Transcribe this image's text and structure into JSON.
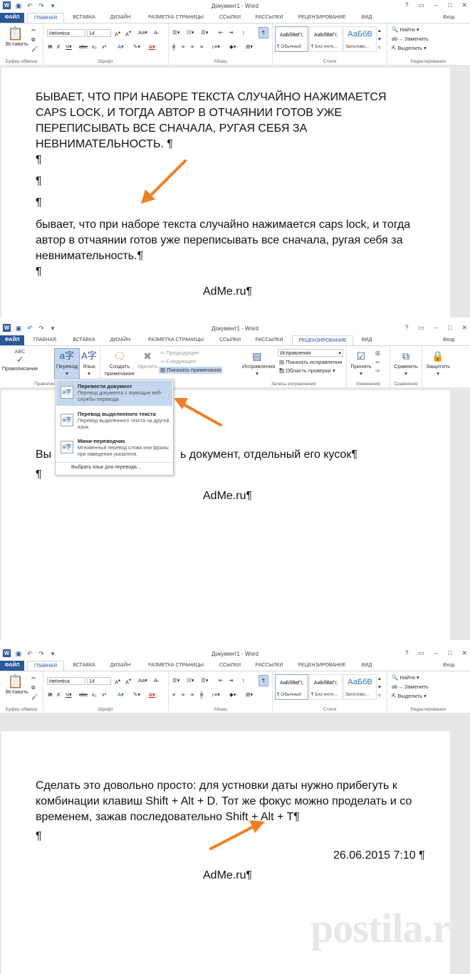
{
  "panels": [
    {
      "title": "Документ1 - Word",
      "tabs": [
        "ФАЙЛ",
        "ГЛАВНАЯ",
        "ВСТАВКА",
        "ДИЗАЙН",
        "РАЗМЕТКА СТРАНИЦЫ",
        "ССЫЛКИ",
        "РАССЫЛКИ",
        "РЕЦЕНЗИРОВАНИЕ",
        "ВИД"
      ],
      "signin": "Вход",
      "ribbon": {
        "paste": "Вставить",
        "clipboard": "Буфер обмена",
        "font_name": "Helvetica",
        "font_size": "14",
        "font_group": "Шрифт",
        "para_group": "Абзац",
        "styles": [
          {
            "preview": "АаБбВвГг,",
            "name": "¶ Обычный"
          },
          {
            "preview": "АаБбВвГг,",
            "name": "¶ Без инте..."
          },
          {
            "preview": "АаБбВ",
            "name": "Заголово..."
          }
        ],
        "styles_group": "Стили",
        "find": "Найти",
        "replace": "Заменить",
        "select": "Выделить",
        "edit_group": "Редактирование"
      },
      "doc": {
        "caps_lines": [
          "БЫВАЕТ, ЧТО ПРИ НАБОРЕ ТЕКСТА СЛУЧАЙНО НАЖИМАЕТСЯ",
          "CAPS LOCK, И ТОГДА АВТОР В ОТЧАЯНИИ ГОТОВ УЖЕ",
          "ПЕРЕПИСЫВАТЬ ВСЕ СНАЧАЛА, РУГАЯ СЕБЯ ЗА",
          "НЕВНИМАТЕЛЬНОСТЬ. ¶"
        ],
        "pilcrows": [
          "¶",
          "¶",
          "¶"
        ],
        "lower_lines": [
          "бывает, что при наборе текста случайно нажимается caps lock, и тогда",
          "автор в отчаянии готов уже переписывать все сначала, ругая себя за",
          "невнимательность.¶"
        ],
        "end_pilcrow": "¶",
        "footer": "AdMe.ru¶"
      }
    },
    {
      "title": "Документ1 - Word",
      "tabs": [
        "ФАЙЛ",
        "ГЛАВНАЯ",
        "ВСТАВКА",
        "ДИЗАЙН",
        "РАЗМЕТКА СТРАНИЦЫ",
        "ССЫЛКИ",
        "РАССЫЛКИ",
        "РЕЦЕНЗИРОВАНИЕ",
        "ВИД"
      ],
      "signin": "Вход",
      "ribbon": {
        "spelling": "Правописание",
        "translate": "Перевод",
        "language": "Язык",
        "create_comment": "Создать примечание",
        "delete": "Удалить",
        "prev": "Предыдущее",
        "next": "Следующее",
        "show_comments": "Показать примечания",
        "corrections": "Исправления",
        "corrections_mode": "Исправления",
        "show_markup": "Показать исправления",
        "review_pane": "Область проверки",
        "accept": "Принять",
        "compare": "Сравнить",
        "protect": "Защитить",
        "proofing_group": "Правописание",
        "tracking_group": "Запись исправлений",
        "changes_group": "Изменения",
        "compare_group": "Сравнение"
      },
      "dropdown": [
        {
          "title": "Перевести документ",
          "desc": "Перевод документа с помощью веб-службы перевода"
        },
        {
          "title": "Перевод выделенного текста",
          "desc": "Перевод выделенного текста на другой язык."
        },
        {
          "title": "Мини-переводчик",
          "desc": "Мгновенный перевод слова или фразы при наведении указателя."
        }
      ],
      "dropdown_footer": "Выбрать язык для перевода...",
      "doc": {
        "line_start": "Вы",
        "line_end": "ь документ, отдельный его кусок¶",
        "pilcrow": "¶",
        "footer": "AdMe.ru¶"
      }
    },
    {
      "title": "Документ1 - Word",
      "tabs": [
        "ФАЙЛ",
        "ГЛАВНАЯ",
        "ВСТАВКА",
        "ДИЗАЙН",
        "РАЗМЕТКА СТРАНИЦЫ",
        "ССЫЛКИ",
        "РАССЫЛКИ",
        "РЕЦЕНЗИРОВАНИЕ",
        "ВИД"
      ],
      "signin": "Вход",
      "ribbon": {
        "paste": "Вставить",
        "clipboard": "Буфер обмена",
        "font_name": "Helvetica",
        "font_size": "14",
        "font_group": "Шрифт",
        "para_group": "Абзац",
        "styles": [
          {
            "preview": "АаБбВвГг,",
            "name": "¶ Обычный"
          },
          {
            "preview": "АаБбВвГг,",
            "name": "¶ Без инте..."
          },
          {
            "preview": "АаБбВ",
            "name": "Заголово..."
          }
        ],
        "styles_group": "Стили",
        "find": "Найти",
        "replace": "Заменить",
        "select": "Выделить",
        "edit_group": "Редактирование"
      },
      "doc": {
        "lines": [
          "Сделать это довольно просто: для устновки даты нужно прибегуть к",
          "комбинации клавиш Shift + Alt + D. Тот же фокус можно проделать и со",
          "временем, зажав последовательно Shift + Alt + T¶"
        ],
        "pilcrow": "¶",
        "date": "26.06.2015 7:10 ¶",
        "footer": "AdMe.ru¶"
      }
    }
  ],
  "watermark": "postila.ru",
  "colors": {
    "accent": "#2b579a",
    "arrow": "#f07f24",
    "tab_text": "#444444"
  }
}
